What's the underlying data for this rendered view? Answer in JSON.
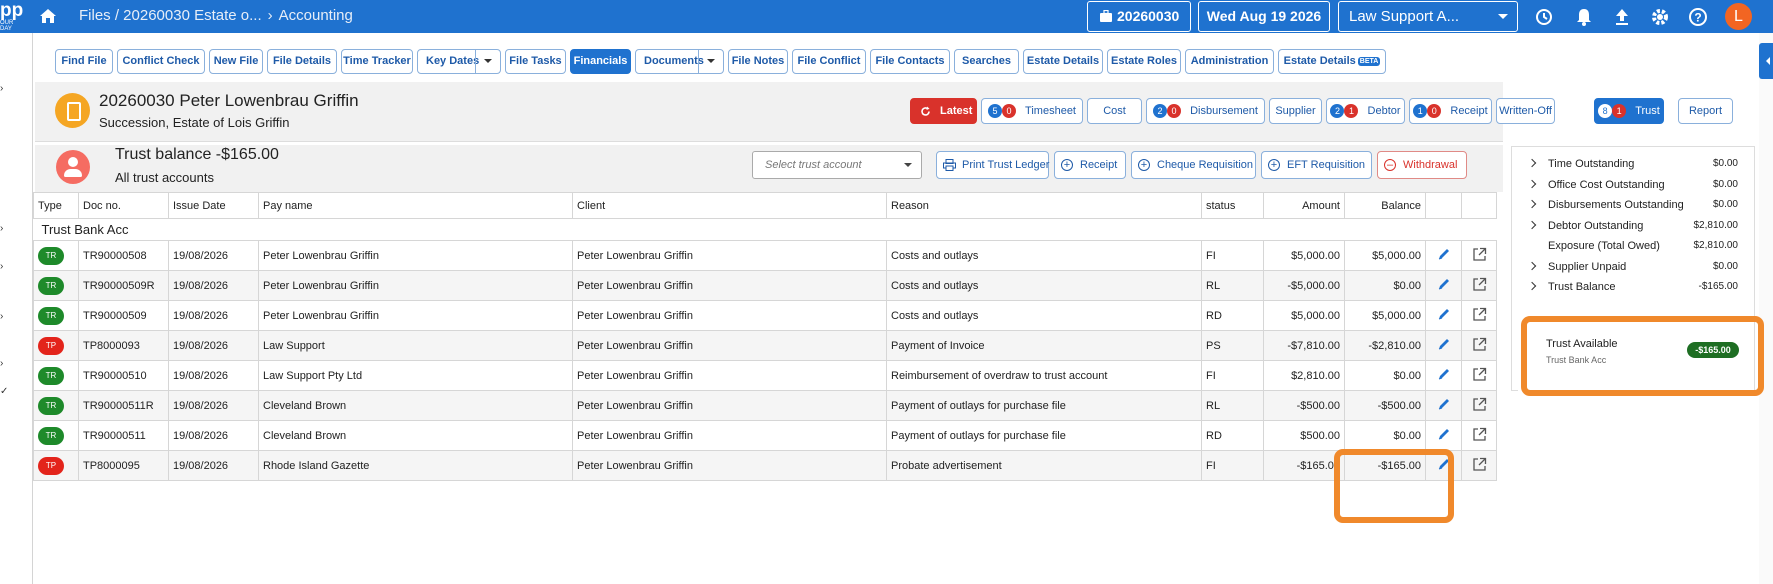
{
  "app": {
    "logo_text": "pp",
    "logo_sub": "OUR DAY"
  },
  "topbar": {
    "breadcrumb": "Files / 20260030 Estate o...",
    "breadcrumb_sep": "›",
    "breadcrumb_current": "Accounting",
    "file_number": "20260030",
    "date": "Wed Aug 19 2026",
    "firm_select": "Law Support A...",
    "avatar_letter": "L"
  },
  "left_strip": {
    "chevron": "›",
    "check": "✓"
  },
  "nav_tabs": [
    {
      "label": "Find File"
    },
    {
      "label": "Conflict Check"
    },
    {
      "label": "New File"
    },
    {
      "label": "File Details"
    },
    {
      "label": "Time Tracker"
    },
    {
      "label": "Key Dates"
    },
    {
      "label": "File Tasks"
    },
    {
      "label": "Financials"
    },
    {
      "label": "Documents"
    },
    {
      "label": "File Notes"
    },
    {
      "label": "File Conflict"
    },
    {
      "label": "File Contacts"
    },
    {
      "label": "Searches"
    },
    {
      "label": "Estate Details"
    },
    {
      "label": "Estate Roles"
    },
    {
      "label": "Administration"
    },
    {
      "label": "Estate Details",
      "badge": "BETA"
    }
  ],
  "file_header": {
    "title": "20260030 Peter Lowenbrau Griffin",
    "subtitle": "Succession, Estate of Lois Griffin"
  },
  "fin_buttons": {
    "latest": "Latest",
    "timesheet": {
      "label": "Timesheet",
      "b1": "5",
      "b2": "0"
    },
    "cost": "Cost",
    "disbursement": {
      "label": "Disbursement",
      "b1": "2",
      "b2": "0"
    },
    "supplier": "Supplier",
    "debtor": {
      "label": "Debtor",
      "b1": "2",
      "b2": "1"
    },
    "receipt": {
      "label": "Receipt",
      "b1": "1",
      "b2": "0"
    },
    "written_off": "Written-Off",
    "trust": {
      "label": "Trust",
      "b1": "8",
      "b2": "1"
    },
    "report": "Report"
  },
  "trust_bar": {
    "balance": "Trust balance -$165.00",
    "scope": "All trust accounts",
    "select_placeholder": "Select trust account",
    "print_ledger": "Print Trust Ledger",
    "receipt": "Receipt",
    "cheque": "Cheque Requisition",
    "eft": "EFT Requisition",
    "withdrawal": "Withdrawal"
  },
  "table": {
    "headers": [
      "Type",
      "Doc no.",
      "Issue Date",
      "Pay name",
      "Client",
      "Reason",
      "status",
      "Amount",
      "Balance"
    ],
    "group": "Trust Bank Acc",
    "rows": [
      {
        "type": "TR",
        "doc": "TR90000508",
        "date": "19/08/2026",
        "pay": "Peter Lowenbrau Griffin",
        "client": "Peter Lowenbrau Griffin",
        "reason": "Costs and outlays",
        "status": "FI",
        "amount": "$5,000.00",
        "balance": "$5,000.00"
      },
      {
        "type": "TR",
        "doc": "TR90000509R",
        "date": "19/08/2026",
        "pay": "Peter Lowenbrau Griffin",
        "client": "Peter Lowenbrau Griffin",
        "reason": "Costs and outlays",
        "status": "RL",
        "amount": "-$5,000.00",
        "balance": "$0.00"
      },
      {
        "type": "TR",
        "doc": "TR90000509",
        "date": "19/08/2026",
        "pay": "Peter Lowenbrau Griffin",
        "client": "Peter Lowenbrau Griffin",
        "reason": "Costs and outlays",
        "status": "RD",
        "amount": "$5,000.00",
        "balance": "$5,000.00"
      },
      {
        "type": "TP",
        "doc": "TP8000093",
        "date": "19/08/2026",
        "pay": "Law Support",
        "client": "Peter Lowenbrau Griffin",
        "reason": "Payment of Invoice",
        "status": "PS",
        "amount": "-$7,810.00",
        "balance": "-$2,810.00"
      },
      {
        "type": "TR",
        "doc": "TR90000510",
        "date": "19/08/2026",
        "pay": "Law Support Pty Ltd",
        "client": "Peter Lowenbrau Griffin",
        "reason": "Reimbursement of overdraw to trust account",
        "status": "FI",
        "amount": "$2,810.00",
        "balance": "$0.00"
      },
      {
        "type": "TR",
        "doc": "TR90000511R",
        "date": "19/08/2026",
        "pay": "Cleveland Brown",
        "client": "Peter Lowenbrau Griffin",
        "reason": "Payment of outlays for purchase file",
        "status": "RL",
        "amount": "-$500.00",
        "balance": "-$500.00"
      },
      {
        "type": "TR",
        "doc": "TR90000511",
        "date": "19/08/2026",
        "pay": "Cleveland Brown",
        "client": "Peter Lowenbrau Griffin",
        "reason": "Payment of outlays for purchase file",
        "status": "RD",
        "amount": "$500.00",
        "balance": "$0.00"
      },
      {
        "type": "TP",
        "doc": "TP8000095",
        "date": "19/08/2026",
        "pay": "Rhode Island Gazette",
        "client": "Peter Lowenbrau Griffin",
        "reason": "Probate advertisement",
        "status": "FI",
        "amount": "-$165.00",
        "balance": "-$165.00"
      }
    ]
  },
  "summary": [
    {
      "label": "Time Outstanding",
      "value": "$0.00",
      "chevron": true
    },
    {
      "label": "Office Cost Outstanding",
      "value": "$0.00",
      "chevron": true
    },
    {
      "label": "Disbursements Outstanding",
      "value": "$0.00",
      "chevron": true
    },
    {
      "label": "Debtor Outstanding",
      "value": "$2,810.00",
      "chevron": true
    },
    {
      "label": "Exposure (Total Owed)",
      "value": "$2,810.00",
      "chevron": false
    },
    {
      "label": "Supplier Unpaid",
      "value": "$0.00",
      "chevron": true
    },
    {
      "label": "Trust Balance",
      "value": "-$165.00",
      "chevron": true
    }
  ],
  "trust_available": {
    "label": "Trust Available",
    "account": "Trust Bank Acc",
    "amount": "-$165.00"
  },
  "colors": {
    "brand_blue": "#1f72cf",
    "highlight_orange": "#f0892b",
    "tr_green": "#1e8a2a",
    "tp_red": "#e3241b"
  }
}
